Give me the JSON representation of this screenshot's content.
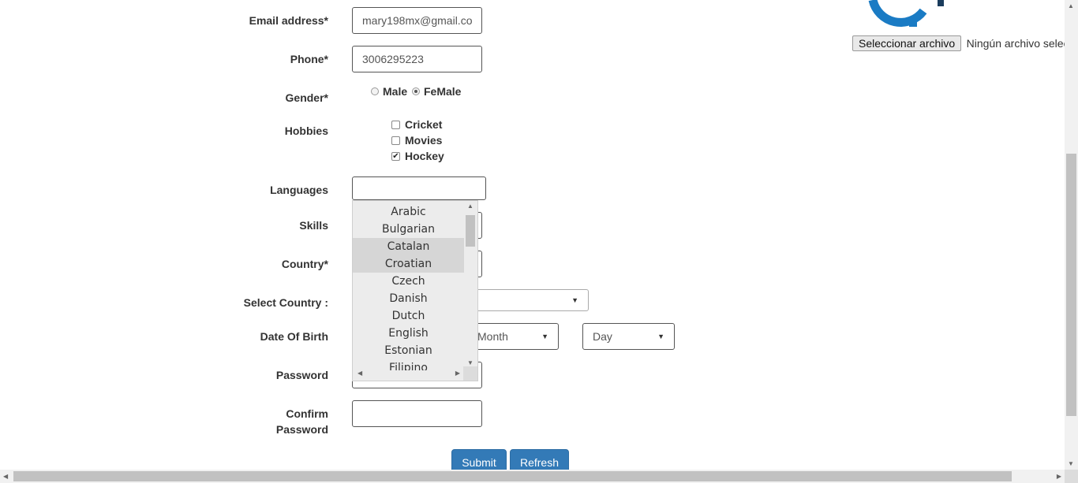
{
  "form": {
    "email": {
      "label": "Email address*",
      "value": "mary198mx@gmail.co"
    },
    "phone": {
      "label": "Phone*",
      "value": "3006295223"
    },
    "gender": {
      "label": "Gender*",
      "options": [
        {
          "label": "Male",
          "selected": false
        },
        {
          "label": "FeMale",
          "selected": true
        }
      ]
    },
    "hobbies": {
      "label": "Hobbies",
      "options": [
        {
          "label": "Cricket",
          "checked": false
        },
        {
          "label": "Movies",
          "checked": false
        },
        {
          "label": "Hockey",
          "checked": true
        }
      ]
    },
    "languages": {
      "label": "Languages",
      "value": ""
    },
    "skills": {
      "label": "Skills"
    },
    "country": {
      "label": "Country*"
    },
    "select_country": {
      "label": "Select Country :"
    },
    "dob": {
      "label": "Date Of Birth",
      "month": "Month",
      "day": "Day"
    },
    "password": {
      "label": "Password"
    },
    "confirm_password": {
      "label_line1": "Confirm",
      "label_line2": "Password"
    }
  },
  "language_dropdown": {
    "items": [
      "Arabic",
      "Bulgarian",
      "Catalan",
      "Croatian",
      "Czech",
      "Danish",
      "Dutch",
      "English",
      "Estonian",
      "Filipino"
    ],
    "highlighted": [
      "Catalan",
      "Croatian"
    ]
  },
  "file_upload": {
    "button": "Seleccionar archivo",
    "status": "Ningún archivo seleccionado"
  },
  "buttons": {
    "submit": "Submit",
    "refresh": "Refresh"
  },
  "colors": {
    "primary": "#337ab7",
    "logo_blue": "#1a7bc4"
  }
}
